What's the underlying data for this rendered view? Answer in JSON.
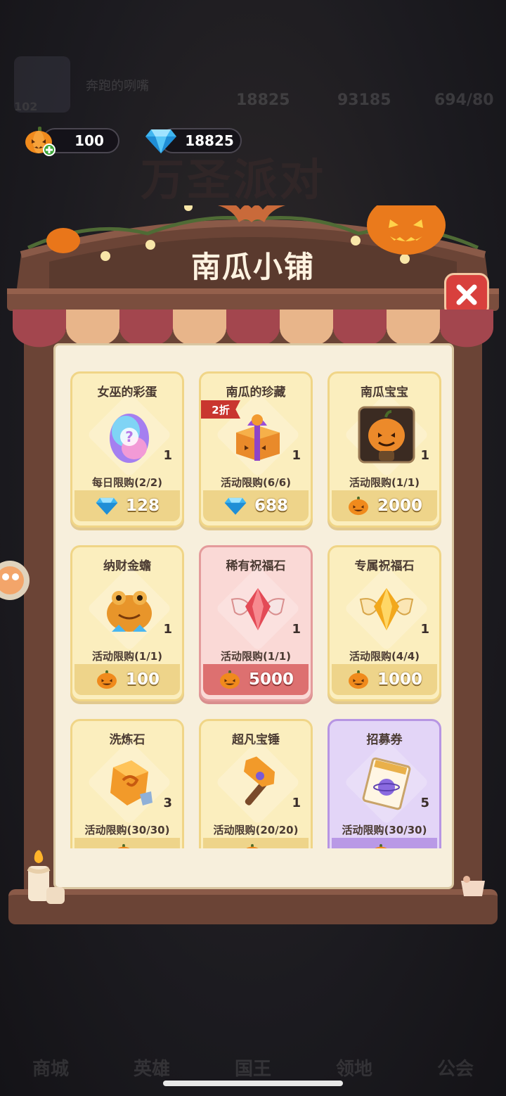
{
  "background": {
    "player_name": "奔跑的咧嘴",
    "level": "102",
    "stats": [
      "18825",
      "93185",
      "694/80"
    ],
    "nav": [
      "商城",
      "英雄",
      "国王",
      "领地",
      "公会"
    ]
  },
  "currency": {
    "pumpkin_amount": "100",
    "gem_amount": "18825",
    "pumpkin_icon": "pumpkin-add-icon",
    "gem_icon": "diamond-icon"
  },
  "event_title": "万圣派对",
  "shop": {
    "title": "南瓜小铺",
    "close_icon": "close-icon",
    "items": [
      {
        "name": "女巫的彩蛋",
        "qty": "1",
        "limit": "每日限购(2/2)",
        "price": "128",
        "currency": "gem",
        "icon": "egg-icon",
        "style": "yellow",
        "tag": ""
      },
      {
        "name": "南瓜的珍藏",
        "qty": "1",
        "limit": "活动限购(6/6)",
        "price": "688",
        "currency": "gem",
        "icon": "gift-box-icon",
        "style": "yellow",
        "tag": "2折"
      },
      {
        "name": "南瓜宝宝",
        "qty": "1",
        "limit": "活动限购(1/1)",
        "price": "2000",
        "currency": "pumpkin",
        "icon": "pumpkin-baby-icon",
        "style": "yellow",
        "tag": ""
      },
      {
        "name": "纳财金蟾",
        "qty": "1",
        "limit": "活动限购(1/1)",
        "price": "100",
        "currency": "pumpkin",
        "icon": "golden-toad-icon",
        "style": "yellow",
        "tag": ""
      },
      {
        "name": "稀有祝福石",
        "qty": "1",
        "limit": "活动限购(1/1)",
        "price": "5000",
        "currency": "pumpkin",
        "icon": "red-wing-gem-icon",
        "style": "red",
        "tag": ""
      },
      {
        "name": "专属祝福石",
        "qty": "1",
        "limit": "活动限购(4/4)",
        "price": "1000",
        "currency": "pumpkin",
        "icon": "gold-wing-gem-icon",
        "style": "yellow",
        "tag": ""
      },
      {
        "name": "洗炼石",
        "qty": "3",
        "limit": "活动限购(30/30)",
        "price": "",
        "currency": "pumpkin",
        "icon": "refine-stone-icon",
        "style": "yellow",
        "tag": ""
      },
      {
        "name": "超凡宝锤",
        "qty": "1",
        "limit": "活动限购(20/20)",
        "price": "",
        "currency": "pumpkin",
        "icon": "hammer-icon",
        "style": "yellow",
        "tag": ""
      },
      {
        "name": "招募券",
        "qty": "5",
        "limit": "活动限购(30/30)",
        "price": "",
        "currency": "pumpkin",
        "icon": "recruit-ticket-icon",
        "style": "purple",
        "tag": ""
      }
    ]
  },
  "colors": {
    "frame_wood": "#6b4436",
    "close_red": "#d8403d",
    "card_yellow": "#fbeebe",
    "card_red": "#fad9d6",
    "card_purple": "#e3d5f7"
  }
}
